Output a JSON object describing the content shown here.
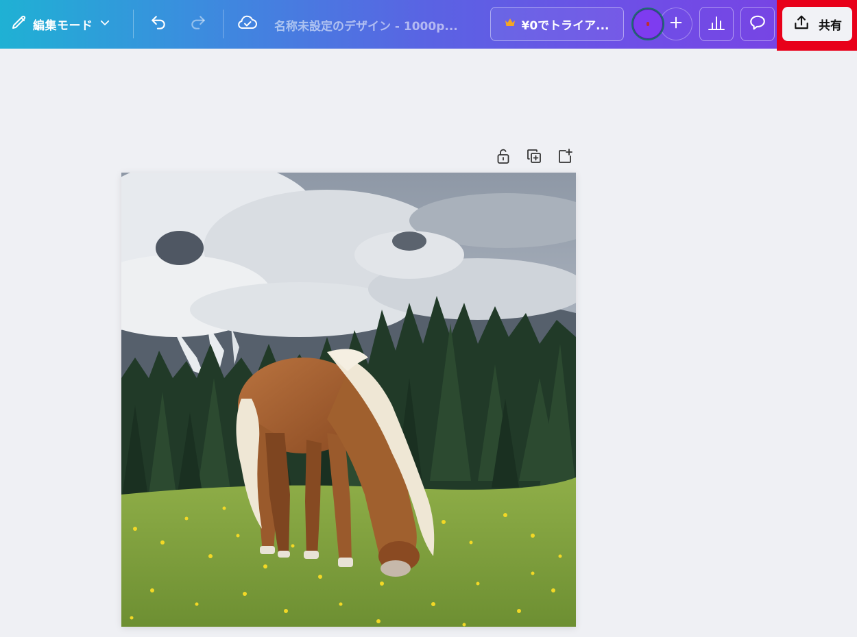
{
  "header": {
    "edit_mode_label": "編集モード",
    "doc_title": "名称未設定のデザイン - 1000p...",
    "trial_label": "¥0でトライア...",
    "share_label": "共有"
  },
  "icons": {
    "edit": "pencil-icon",
    "dropdown": "chevron-down-icon",
    "undo": "undo-icon",
    "redo": "redo-icon",
    "save_status": "cloud-check-icon",
    "crown": "crown-icon",
    "add": "plus-icon",
    "insights": "bar-chart-icon",
    "comment": "comment-icon",
    "share": "upload-icon",
    "lock": "unlock-icon",
    "duplicate": "duplicate-page-icon",
    "add_page": "add-page-icon"
  },
  "canvas": {
    "image_alt": "草原で草を食む栗毛の馬と、雲に覆われた山と森の写真"
  },
  "colors": {
    "share_highlight": "#e8001a",
    "crown": "#f5a623",
    "avatar": "#7e3cf0"
  }
}
